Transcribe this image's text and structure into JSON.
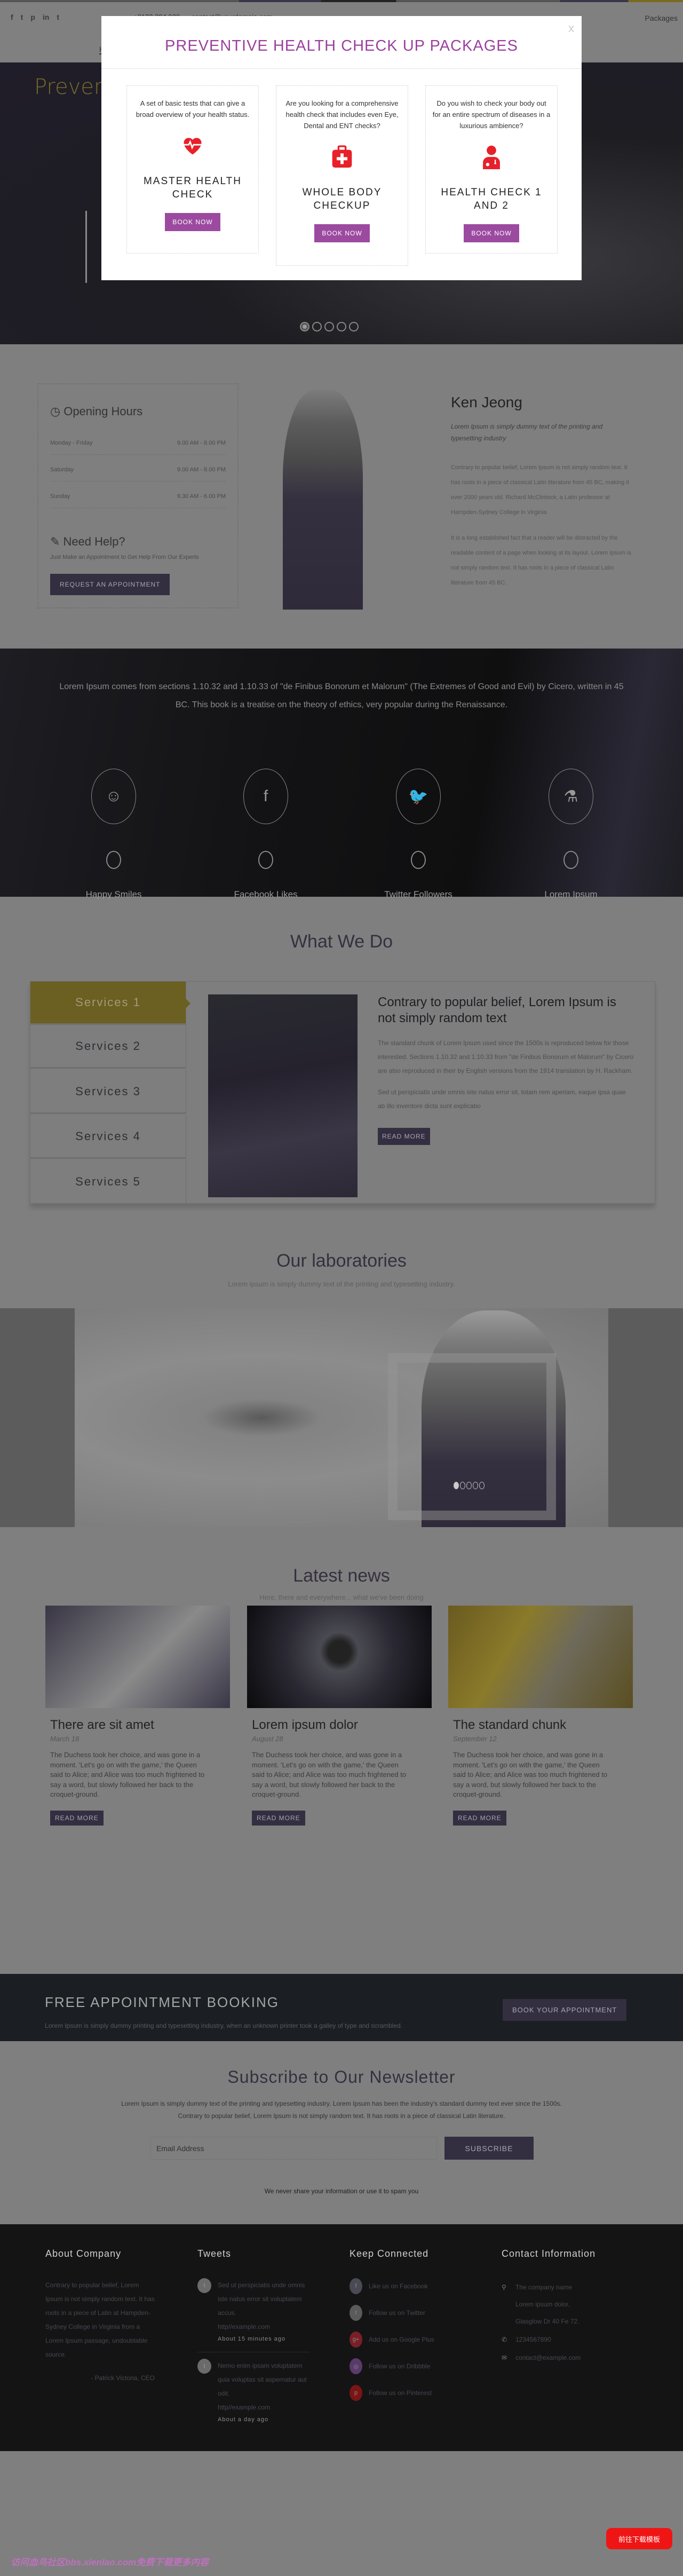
{
  "header": {
    "social_icons": [
      "facebook-icon",
      "twitter-icon",
      "pinterest-icon",
      "linkedin-icon",
      "tumblr-icon"
    ],
    "phone": "+0123 384 920",
    "email": "contact@yourdomain.com",
    "packages_link": "Packages",
    "nav_first_letter": "H"
  },
  "hero": {
    "title": "Preventi",
    "slide_count": 5,
    "active_slide": 1
  },
  "modal": {
    "title": "PREVENTIVE HEALTH CHECK UP PACKAGES",
    "close": "x",
    "accent": "#9c4aa0",
    "packages": [
      {
        "description": "A set of basic tests that can give a broad overview of your health status.",
        "icon": "heartbeat-icon",
        "name": "MASTER HEALTH CHECK",
        "button": "BOOK NOW"
      },
      {
        "description": "Are you looking for a comprehensive health check that includes even Eye, Dental and ENT checks?",
        "icon": "medical-kit-icon",
        "name": "WHOLE BODY CHECKUP",
        "button": "BOOK NOW"
      },
      {
        "description": "Do you wish to check your body out for an entire spectrum of diseases in a luxurious ambience?",
        "icon": "doctor-icon",
        "name": "HEALTH CHECK 1 AND 2",
        "button": "BOOK NOW"
      }
    ]
  },
  "hours": {
    "title": "Opening Hours",
    "rows": [
      {
        "day": "Monday - Friday",
        "time": "9.00 AM - 8.00 PM"
      },
      {
        "day": "Saturday",
        "time": "9.00 AM - 8.00 PM"
      },
      {
        "day": "Sunday",
        "time": "9.30 AM - 6.00 PM"
      }
    ],
    "help_title": "Need Help?",
    "help_text": "Just Make an Appointment to Get Help From Our Experts",
    "button": "REQUEST AN APPOINTMENT"
  },
  "doctor": {
    "name": "Ken Jeong",
    "lead": "Lorem Ipsum is simply dummy text of the printing and typesetting industry",
    "p1": "Contrary to popular belief, Lorem Ipsum is not simply random text. It has roots in a piece of classical Latin literature from 45 BC, making it over 2000 years old. Richard McClintock, a Latin professor at Hampden-Sydney College in Virginia",
    "p2": "It is a long established fact that a reader will be distracted by the readable content of a page when looking at its layout. Lorem Ipsum is not simply random text. It has roots in a piece of classical Latin literature from 45 BC."
  },
  "stats": {
    "text": "Lorem Ipsum comes from sections 1.10.32 and 1.10.33 of \"de Finibus Bonorum et Malorum\" (The Extremes of Good and Evil) by Cicero, written in 45 BC. This book is a treatise on the theory of ethics, very popular during the Renaissance.",
    "items": [
      {
        "icon": "smiley-icon",
        "glyph": "☺",
        "value": "0",
        "label": "Happy Smiles"
      },
      {
        "icon": "facebook-icon",
        "glyph": "f",
        "value": "0",
        "label": "Facebook Likes"
      },
      {
        "icon": "twitter-icon",
        "glyph": "🐦",
        "value": "0",
        "label": "Twitter Followers"
      },
      {
        "icon": "flask-icon",
        "glyph": "⚗",
        "value": "0",
        "label": "Lorem Ipsum"
      }
    ]
  },
  "services": {
    "title": "What We Do",
    "tabs": [
      "Services 1",
      "Services 2",
      "Services 3",
      "Services 4",
      "Services 5"
    ],
    "active_tab": 0,
    "heading": "Contrary to popular belief, Lorem Ipsum is not simply random text",
    "p1": "The standard chunk of Lorem Ipsum used since the 1500s is reproduced below for those interested. Sections 1.10.32 and 1.10.33 from \"de Finibus Bonorum et Malorum\" by Cicero are also reproduced in their by English versions from the 1914 translation by H. Rackham.",
    "p2": "Sed ut perspiciatis unde omnis iste natus error sit, totam rem aperiam, eaque ipsa quae ab illo inventore dicta sunt explicabo",
    "button": "READ MORE"
  },
  "labs": {
    "title": "Our laboratories",
    "subtitle": "Lorem ipsum is simply dummy text of the printing and typesetting industry.",
    "slide_count": 5
  },
  "news": {
    "title": "Latest news",
    "subtitle": "Here, there and everywhere... what we've been doing",
    "items": [
      {
        "title": "There are sit amet",
        "date": "March 18",
        "body": "The Duchess took her choice, and was gone in a moment. 'Let's go on with the game,' the Queen said to Alice; and Alice was too much frightened to say a word, but slowly followed her back to the croquet-ground.",
        "button": "READ MORE"
      },
      {
        "title": "Lorem ipsum dolor",
        "date": "August 28",
        "body": "The Duchess took her choice, and was gone in a moment. 'Let's go on with the game,' the Queen said to Alice; and Alice was too much frightened to say a word, but slowly followed her back to the croquet-ground.",
        "button": "READ MORE"
      },
      {
        "title": "The standard chunk",
        "date": "September 12",
        "body": "The Duchess took her choice, and was gone in a moment. 'Let's go on with the game,' the Queen said to Alice; and Alice was too much frightened to say a word, but slowly followed her back to the croquet-ground.",
        "button": "READ MORE"
      }
    ]
  },
  "appointment": {
    "title": "FREE APPOINTMENT BOOKING",
    "text": "Lorem Ipsum is simply dummy printing and typesetting industry, when an unknown printer took a galley of type and scrambled.",
    "button": "BOOK YOUR APPOINTMENT"
  },
  "newsletter": {
    "title": "Subscribe to Our Newsletter",
    "text1": "Lorem Ipsum is simply dummy text of the printing and typesetting industry. Lorem Ipsum has been the industry's standard dummy text ever since the 1500s.",
    "text2": "Contrary to popular belief, Lorem Ipsum is not simply random text. It has roots in a piece of classical Latin literature.",
    "placeholder": "Email Address",
    "button": "SUBSCRIBE",
    "note": "We never share your information or use it to spam you"
  },
  "footer": {
    "about": {
      "title": "About Company",
      "text": "Contrary to popular belief, Lorem Ipsum is not simply random text. It has roots in a piece of Latin at Hampden-Sydney College in Virginia from a Lorem Ipsum passage, undoubtable source.",
      "signature": "- Patrick Victoria, CEO"
    },
    "tweets": {
      "title": "Tweets",
      "items": [
        {
          "text": "Sed ut perspiciatis unde omnis iste natus error sit voluptatem accus.",
          "link": "http//example.com",
          "time": "About 15 minutes ago"
        },
        {
          "text": "Nemo enim ipsam voluptatem quia voluptas sit aspernatur aut odit.",
          "link": "http//example.com",
          "time": "About a day ago"
        }
      ]
    },
    "connect": {
      "title": "Keep Connected",
      "items": [
        {
          "label": "Like us on Facebook",
          "icon": "facebook-icon",
          "glyph": "f",
          "color": "#4a4a55"
        },
        {
          "label": "Follow us on Twitter",
          "icon": "twitter-icon",
          "glyph": "t",
          "color": "#5a5a5a"
        },
        {
          "label": "Add us on Google Plus",
          "icon": "google-plus-icon",
          "glyph": "g+",
          "color": "#7a1f28"
        },
        {
          "label": "Follow us on Dribbble",
          "icon": "dribbble-icon",
          "glyph": "◎",
          "color": "#5a3a6a"
        },
        {
          "label": "Follow us on Pinterest",
          "icon": "pinterest-icon",
          "glyph": "p",
          "color": "#7a1515"
        }
      ]
    },
    "contact": {
      "title": "Contact Information",
      "company": "The company name",
      "address1": "Lorem ipsum dolor,",
      "address2": "Glasglow Dr 40 Fe 72.",
      "phone": "1234567890",
      "email": "contact@example.com"
    }
  },
  "overlay": {
    "download_button": "前往下载模板",
    "watermark": "访问血鸟社区bbs.xienlao.com免费下载更多内容"
  }
}
